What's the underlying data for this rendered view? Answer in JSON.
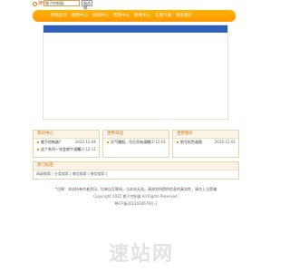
{
  "search": {
    "label": "搜索",
    "input_value": "搬子控制器:",
    "button_label": "站点搜..."
  },
  "nav": {
    "items": [
      "网站首页",
      "图库中心",
      "视频中心",
      "帮助中心",
      "新闻中心",
      "在线下载",
      "联系我们"
    ]
  },
  "panels": [
    {
      "title": "资讯中心",
      "rows": [
        {
          "text": "搬子控制器?",
          "date": "2022-12-06"
        },
        {
          "text": "这个系列一学会就不太难",
          "date": "2022-12-11"
        }
      ]
    },
    {
      "title": "世界日记",
      "rows": [
        {
          "text": "天气播报，号召开始总结",
          "date": "2022-12-01"
        }
      ]
    },
    {
      "title": "世界图片",
      "rows": [
        {
          "text": "怒号形色画图",
          "date": "2022-12-01"
        }
      ]
    }
  ],
  "tags": {
    "title": "热门标签",
    "text": "高级搜索 | 分类搜索 | 微信搜索 | 微信搜索 |"
  },
  "footer": {
    "notice": "*注释：本站所有作者资讯，均来自互联网，与本站无关。请浏览所提供信息的真实性，请勿上当受骗",
    "copyright": "Copyright 2022 搬子控制器 All Rights Reserved.",
    "icp": "粤ICP备2022034678号-1"
  },
  "watermark": "速站网",
  "colors": {
    "nav_orange": "#ff9f00",
    "banner_strip": "#2f5fb7",
    "panel_title": "#d46b00"
  }
}
